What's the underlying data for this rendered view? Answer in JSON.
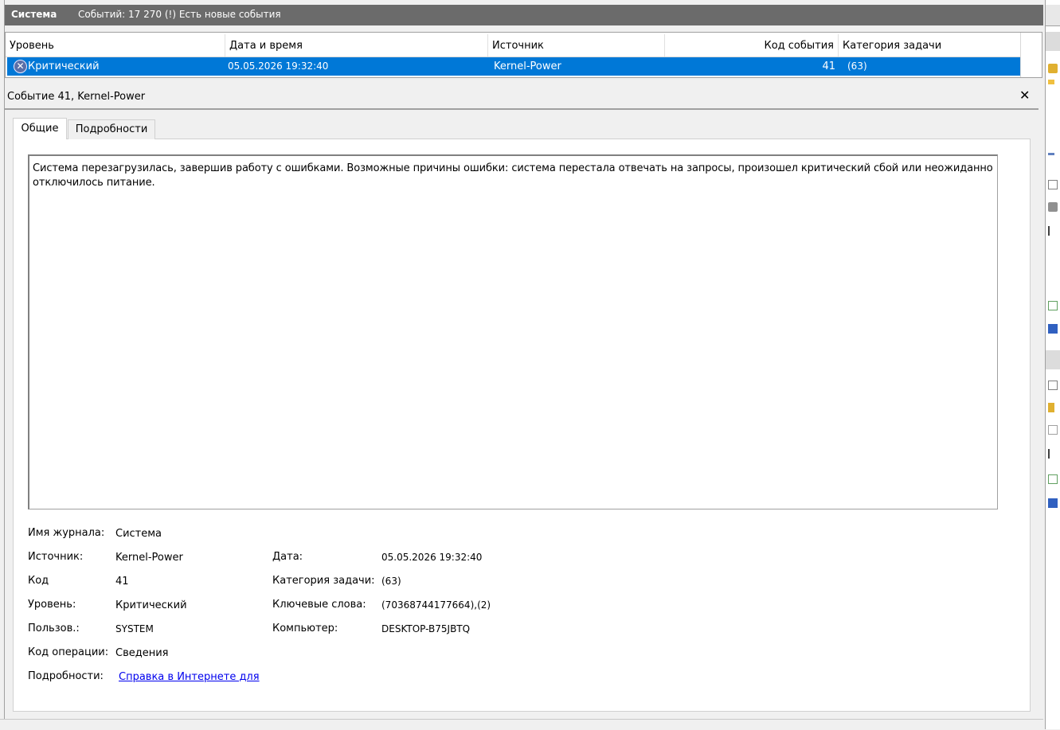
{
  "header": {
    "log_name": "Система",
    "status": "Событий: 17 270 (!) Есть новые события"
  },
  "grid": {
    "columns": [
      "Уровень",
      "Дата и время",
      "Источник",
      "Код события",
      "Категория задачи"
    ],
    "selected_row": {
      "level": "Критический",
      "datetime": "05.05.2026 19:32:40",
      "source": "Kernel-Power",
      "event_id": "41",
      "task_category": "(63)"
    }
  },
  "detail": {
    "title": "Событие 41, Kernel-Power",
    "close_glyph": "✕",
    "tabs": [
      "Общие",
      "Подробности"
    ],
    "description": "Система перезагрузилась, завершив работу с ошибками. Возможные причины ошибки: система перестала отвечать на запросы, произошел критический сбой или неожиданно отключилось питание.",
    "fields": {
      "log_name_label": "Имя журнала:",
      "log_name_value": "Система",
      "source_label": "Источник:",
      "source_value": "Kernel-Power",
      "date_label": "Дата:",
      "date_value": "05.05.2026 19:32:40",
      "code_label": "Код",
      "code_value": "41",
      "category_label": "Категория задачи:",
      "category_value": "(63)",
      "level_label": "Уровень:",
      "level_value": "Критический",
      "keywords_label": "Ключевые слова:",
      "keywords_value": "(70368744177664),(2)",
      "user_label": "Пользов.:",
      "user_value": "SYSTEM",
      "computer_label": "Компьютер:",
      "computer_value": "DESKTOP-B75JBTQ",
      "opcode_label": "Код операции:",
      "opcode_value": "Сведения",
      "more_label": "Подробности:",
      "more_link": "Справка в Интернете для "
    }
  },
  "colors": {
    "selection": "#0078d7",
    "header_bar": "#6b6b6b",
    "link": "#0000ee"
  }
}
